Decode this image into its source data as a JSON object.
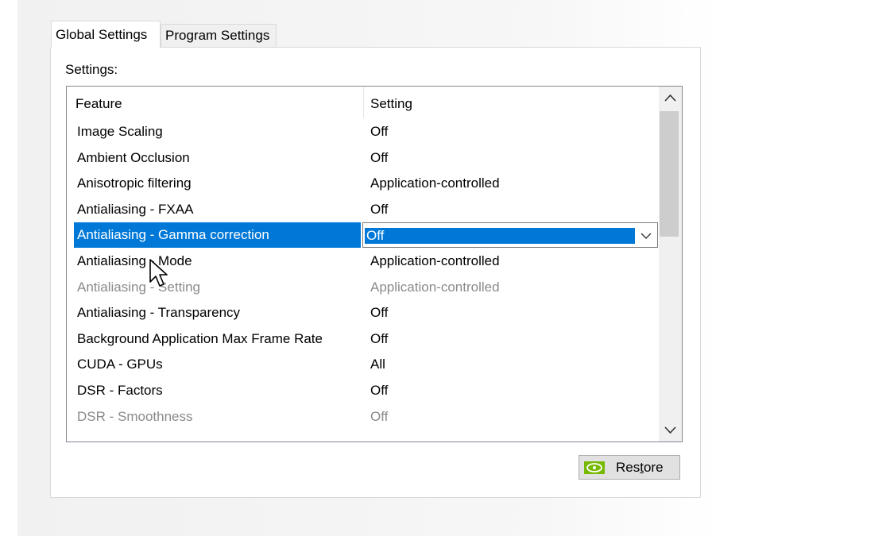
{
  "tabs": [
    {
      "label": "Global Settings",
      "active": true
    },
    {
      "label": "Program Settings",
      "active": false
    }
  ],
  "settings_label": "Settings:",
  "grid": {
    "columns": [
      "Feature",
      "Setting"
    ],
    "rows": [
      {
        "feature": "Image Scaling",
        "setting": "Off",
        "state": "normal"
      },
      {
        "feature": "Ambient Occlusion",
        "setting": "Off",
        "state": "normal"
      },
      {
        "feature": "Anisotropic filtering",
        "setting": "Application-controlled",
        "state": "normal"
      },
      {
        "feature": "Antialiasing - FXAA",
        "setting": "Off",
        "state": "normal"
      },
      {
        "feature": "Antialiasing - Gamma correction",
        "setting": "Off",
        "state": "selected"
      },
      {
        "feature": "Antialiasing - Mode",
        "setting": "Application-controlled",
        "state": "normal"
      },
      {
        "feature": "Antialiasing - Setting",
        "setting": "Application-controlled",
        "state": "disabled"
      },
      {
        "feature": "Antialiasing - Transparency",
        "setting": "Off",
        "state": "normal"
      },
      {
        "feature": "Background Application Max Frame Rate",
        "setting": "Off",
        "state": "normal"
      },
      {
        "feature": "CUDA - GPUs",
        "setting": "All",
        "state": "normal"
      },
      {
        "feature": "DSR - Factors",
        "setting": "Off",
        "state": "normal"
      },
      {
        "feature": "DSR - Smoothness",
        "setting": "Off",
        "state": "disabled"
      }
    ]
  },
  "restore_button": {
    "prefix": "Res",
    "accel": "t",
    "suffix": "ore"
  },
  "colors": {
    "selection": "#0078d7",
    "nvidia_green": "#76b900"
  },
  "icons": [
    "chevron-up-icon",
    "chevron-down-icon",
    "nvidia-logo-icon",
    "mouse-cursor-icon"
  ]
}
